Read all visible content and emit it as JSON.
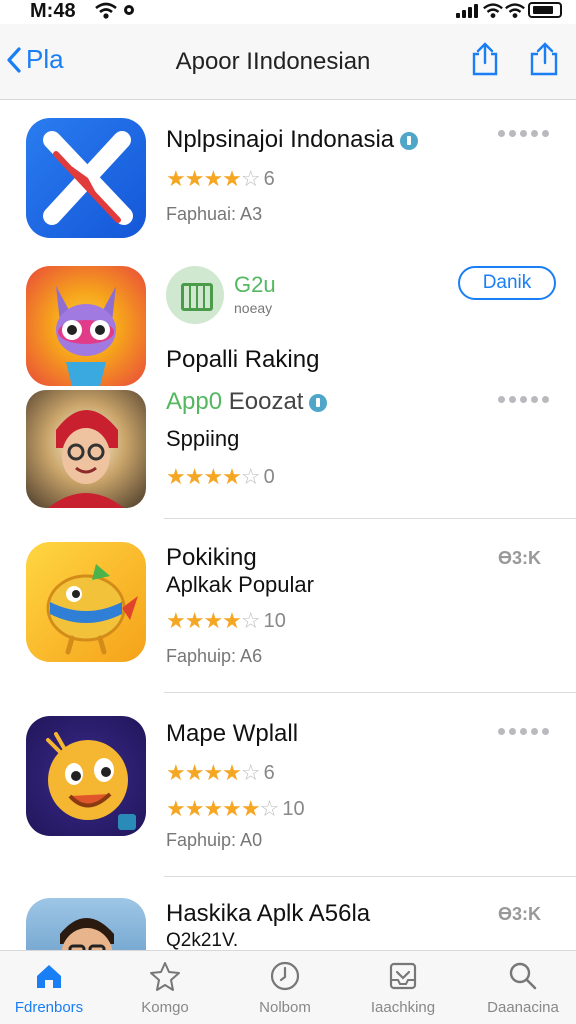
{
  "status_bar": {
    "time": "M:48"
  },
  "nav": {
    "back_label": "Pla",
    "title": "Apoor IIndonesian"
  },
  "apps": [
    {
      "name": "Nplpsinajoi Indonasia",
      "rating_count": "6",
      "meta": "Faphuai: A3"
    },
    {
      "name": "Popalli Raking",
      "highlight": "App0",
      "highlight_rest": "Eoozat",
      "sub": "Sppiing",
      "rating_count": "0"
    },
    {
      "name": "Pokiking",
      "sub": "Aplkak Popular",
      "rating_count": "10",
      "meta": "Faphuip: A6",
      "badge": "Ɵ3:K"
    },
    {
      "name": "Mape Wplall",
      "rating_count": "6",
      "rating_count2": "10",
      "meta": "Faphuip: A0"
    },
    {
      "name": "Haskika Aplk A56la",
      "sub": "Q2k21V.",
      "badge": "Ɵ3:K"
    }
  ],
  "promo": {
    "title": "G2u",
    "subtitle": "noeay",
    "button_label": "Danik"
  },
  "tabs": [
    {
      "label": "Fdrenbors",
      "icon": "home-icon"
    },
    {
      "label": "Komgo",
      "icon": "star-icon"
    },
    {
      "label": "Nolbom",
      "icon": "clock-icon"
    },
    {
      "label": "Iaachking",
      "icon": "inbox-icon"
    },
    {
      "label": "Daanacina",
      "icon": "search-icon"
    }
  ],
  "colors": {
    "accent": "#1a7ef5",
    "star": "#f5a623",
    "green": "#53b860"
  }
}
